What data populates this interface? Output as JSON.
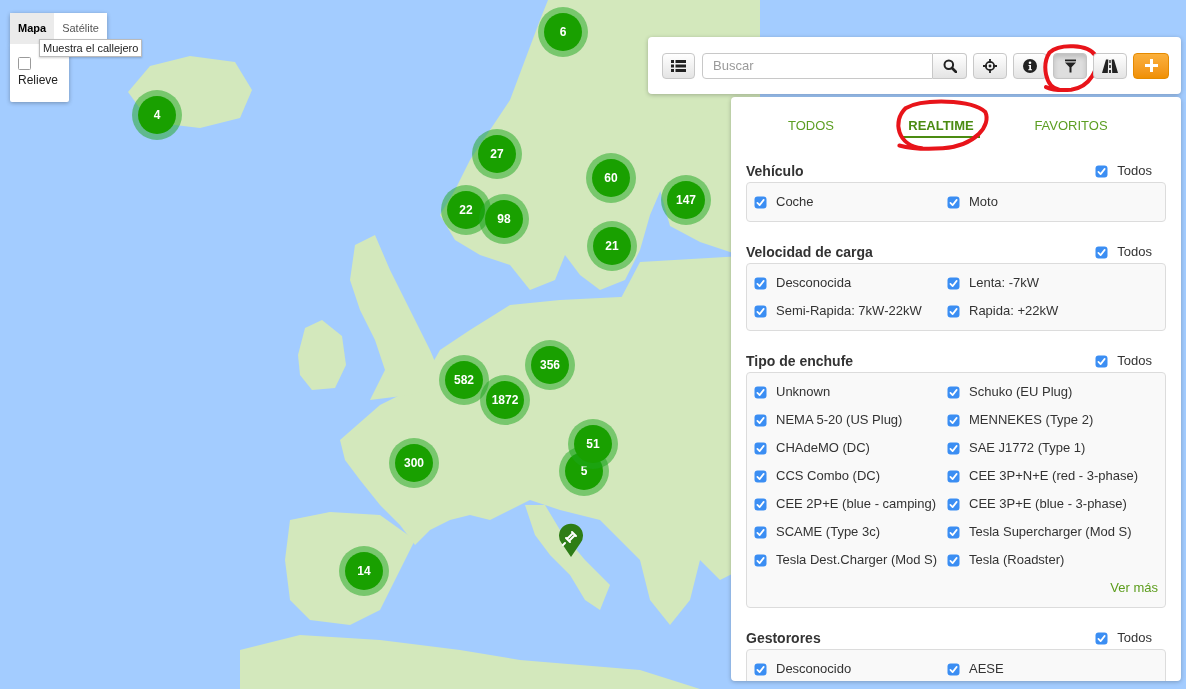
{
  "map_type_control": {
    "options": [
      {
        "label": "Mapa",
        "selected": true
      },
      {
        "label": "Satélite",
        "selected": false
      }
    ],
    "tooltip": "Muestra el callejero",
    "terrain_option": {
      "label": "Relieve",
      "checked": false
    }
  },
  "clusters": [
    {
      "count": "6"
    },
    {
      "count": "4"
    },
    {
      "count": "27"
    },
    {
      "count": "60"
    },
    {
      "count": "147"
    },
    {
      "count": "22"
    },
    {
      "count": "98"
    },
    {
      "count": "21"
    },
    {
      "count": "356"
    },
    {
      "count": "582"
    },
    {
      "count": "1872"
    },
    {
      "count": "5"
    },
    {
      "count": "51"
    },
    {
      "count": "300"
    },
    {
      "count": "14"
    }
  ],
  "toolbar": {
    "list_button": {
      "kind": "list",
      "pressed": false,
      "highlighted": false
    },
    "search": {
      "placeholder": "Buscar",
      "button": {
        "kind": "search",
        "pressed": false,
        "highlighted": false
      }
    },
    "buttons": [
      {
        "kind": "locate",
        "pressed": false,
        "highlighted": false
      },
      {
        "kind": "info",
        "pressed": false,
        "highlighted": false
      },
      {
        "kind": "filter",
        "pressed": true,
        "highlighted": true
      },
      {
        "kind": "road",
        "pressed": false,
        "highlighted": false
      },
      {
        "kind": "add",
        "pressed": false,
        "highlighted": false
      }
    ]
  },
  "filter_panel": {
    "tabs": [
      {
        "label": "TODOS",
        "selected": false,
        "highlighted": false
      },
      {
        "label": "REALTIME",
        "selected": true,
        "highlighted": true
      },
      {
        "label": "FAVORITOS",
        "selected": false,
        "highlighted": false
      }
    ],
    "sections": [
      {
        "title": "Vehículo",
        "select_all": {
          "label": "Todos",
          "checked": true
        },
        "options": [
          {
            "label": "Coche",
            "checked": true
          },
          {
            "label": "Moto",
            "checked": true
          }
        ]
      },
      {
        "title": "Velocidad de carga",
        "select_all": {
          "label": "Todos",
          "checked": true
        },
        "options": [
          {
            "label": "Desconocida",
            "checked": true
          },
          {
            "label": "Lenta: -7kW",
            "checked": true
          },
          {
            "label": "Semi-Rapida: 7kW-22kW",
            "checked": true
          },
          {
            "label": "Rapida: +22kW",
            "checked": true
          }
        ]
      },
      {
        "title": "Tipo de enchufe",
        "select_all": {
          "label": "Todos",
          "checked": true
        },
        "options": [
          {
            "label": "Unknown",
            "checked": true
          },
          {
            "label": "Schuko (EU Plug)",
            "checked": true
          },
          {
            "label": "NEMA 5-20 (US Plug)",
            "checked": true
          },
          {
            "label": "MENNEKES (Type 2)",
            "checked": true
          },
          {
            "label": "CHAdeMO (DC)",
            "checked": true
          },
          {
            "label": "SAE J1772 (Type 1)",
            "checked": true
          },
          {
            "label": "CCS Combo (DC)",
            "checked": true
          },
          {
            "label": "CEE 3P+N+E (red - 3-phase)",
            "checked": true
          },
          {
            "label": "CEE 2P+E (blue - camping)",
            "checked": true
          },
          {
            "label": "CEE 3P+E (blue - 3-phase)",
            "checked": true
          },
          {
            "label": "SCAME (Type 3c)",
            "checked": true
          },
          {
            "label": "Tesla Supercharger (Mod S)",
            "checked": true
          },
          {
            "label": "Tesla Dest.Charger (Mod S)",
            "checked": true
          },
          {
            "label": "Tesla (Roadster)",
            "checked": true
          }
        ],
        "more_link": "Ver más"
      },
      {
        "title": "Gestorores",
        "select_all": {
          "label": "Todos",
          "checked": true
        },
        "options": [
          {
            "label": "Desconocido",
            "checked": true
          },
          {
            "label": "AESE",
            "checked": true
          }
        ]
      }
    ]
  }
}
